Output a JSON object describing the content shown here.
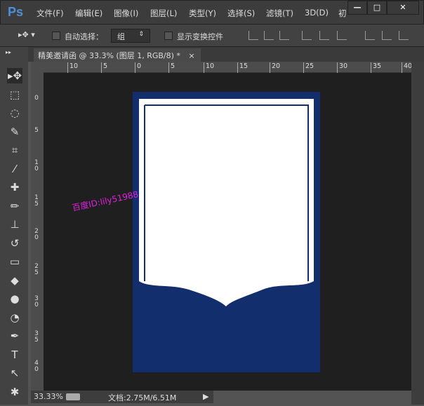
{
  "app": {
    "logo": "Ps",
    "menu": [
      "文件(F)",
      "编辑(E)",
      "图像(I)",
      "图层(L)",
      "类型(Y)",
      "选择(S)",
      "滤镜(T)",
      "3D(D)",
      "初"
    ],
    "window_controls": {
      "minimize": "—",
      "maximize": "□",
      "close": "✕"
    }
  },
  "options": {
    "auto_select_label": "自动选择：",
    "auto_select_checked": false,
    "auto_select_value": "组",
    "show_transform_label": "显示变换控件",
    "show_transform_checked": false
  },
  "tab": {
    "title": "精美邀请函 @ 33.3% (图层 1, RGB/8) *",
    "close": "×"
  },
  "ruler": {
    "h_labels": [
      "10",
      "5",
      "0",
      "5",
      "10",
      "15",
      "20",
      "25",
      "30",
      "35",
      "40"
    ],
    "v_labels": [
      "0",
      "5",
      "10",
      "15",
      "20",
      "25",
      "30",
      "35",
      "40"
    ]
  },
  "document": {
    "background_color": "#132e6d",
    "card_color": "#ffffff"
  },
  "watermark": "百度ID:lily51988",
  "status": {
    "zoom": "33.33%",
    "doc_info": "文档:2.75M/6.51M",
    "arrow": "▶"
  },
  "tools": [
    "move",
    "marquee",
    "lasso",
    "quick-select",
    "crop",
    "eyedropper",
    "healing",
    "brush",
    "stamp",
    "history-brush",
    "eraser",
    "paint-bucket",
    "blur",
    "dodge",
    "pen",
    "type",
    "path-select",
    "shape"
  ]
}
